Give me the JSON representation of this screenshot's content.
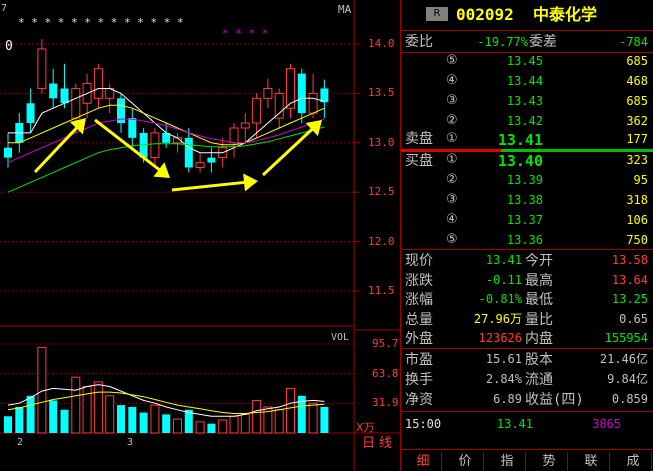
{
  "colors": {
    "up": "#ff3c3c",
    "down": "#00ffff",
    "green": "#00e600",
    "yellow": "#ffff00",
    "white": "#ffffff",
    "magenta": "#d000d0",
    "label": "#c0c0c0",
    "grid": "#a00000"
  },
  "chart": {
    "ma_label": "MA",
    "price_ticks": [
      "14.0",
      "13.5",
      "13.0",
      "12.5",
      "12.0",
      "11.5"
    ],
    "vol_label": "VOL",
    "vol_ticks": [
      "95.7",
      "63.8",
      "31.9"
    ],
    "vol_unit": "X万",
    "left_price_fragment": "0",
    "left_top_fragment": "7",
    "date_labels": [
      "2",
      "3"
    ],
    "period_button": "日线",
    "star_marks": "* * * * * * * * * * * * *",
    "star_marks_magenta": "* * * *"
  },
  "chart_data": {
    "type": "candlestick",
    "price_range": [
      11.3,
      14.2
    ],
    "vol_range": [
      0,
      100
    ],
    "candles": [
      {
        "o": 12.95,
        "h": 13.1,
        "l": 12.75,
        "c": 12.85,
        "v": 18
      },
      {
        "o": 13.2,
        "h": 13.3,
        "l": 12.9,
        "c": 13.0,
        "v": 28
      },
      {
        "o": 13.4,
        "h": 13.55,
        "l": 13.1,
        "c": 13.2,
        "v": 40
      },
      {
        "o": 13.55,
        "h": 14.05,
        "l": 13.5,
        "c": 13.95,
        "v": 92
      },
      {
        "o": 13.6,
        "h": 13.75,
        "l": 13.35,
        "c": 13.45,
        "v": 35
      },
      {
        "o": 13.55,
        "h": 13.8,
        "l": 13.35,
        "c": 13.4,
        "v": 25
      },
      {
        "o": 13.25,
        "h": 13.6,
        "l": 13.1,
        "c": 13.55,
        "v": 60
      },
      {
        "o": 13.4,
        "h": 13.7,
        "l": 13.25,
        "c": 13.6,
        "v": 50
      },
      {
        "o": 13.45,
        "h": 13.8,
        "l": 13.35,
        "c": 13.75,
        "v": 55
      },
      {
        "o": 13.45,
        "h": 13.6,
        "l": 13.3,
        "c": 13.55,
        "v": 40
      },
      {
        "o": 13.45,
        "h": 13.5,
        "l": 13.1,
        "c": 13.2,
        "v": 30
      },
      {
        "o": 13.25,
        "h": 13.35,
        "l": 12.95,
        "c": 13.05,
        "v": 28
      },
      {
        "o": 13.1,
        "h": 13.15,
        "l": 12.8,
        "c": 12.85,
        "v": 22
      },
      {
        "o": 12.85,
        "h": 13.15,
        "l": 12.75,
        "c": 13.1,
        "v": 30
      },
      {
        "o": 13.1,
        "h": 13.2,
        "l": 12.95,
        "c": 13.0,
        "v": 20
      },
      {
        "o": 13.0,
        "h": 13.1,
        "l": 12.9,
        "c": 13.05,
        "v": 15
      },
      {
        "o": 13.05,
        "h": 13.15,
        "l": 12.7,
        "c": 12.75,
        "v": 25
      },
      {
        "o": 12.75,
        "h": 12.9,
        "l": 12.7,
        "c": 12.8,
        "v": 12
      },
      {
        "o": 12.85,
        "h": 12.95,
        "l": 12.7,
        "c": 12.8,
        "v": 10
      },
      {
        "o": 12.85,
        "h": 13.05,
        "l": 12.75,
        "c": 12.95,
        "v": 14
      },
      {
        "o": 13.0,
        "h": 13.2,
        "l": 12.85,
        "c": 13.15,
        "v": 18
      },
      {
        "o": 13.15,
        "h": 13.3,
        "l": 13.0,
        "c": 13.2,
        "v": 20
      },
      {
        "o": 13.2,
        "h": 13.5,
        "l": 13.05,
        "c": 13.45,
        "v": 35
      },
      {
        "o": 13.45,
        "h": 13.65,
        "l": 13.35,
        "c": 13.55,
        "v": 28
      },
      {
        "o": 13.25,
        "h": 13.55,
        "l": 13.15,
        "c": 13.5,
        "v": 25
      },
      {
        "o": 13.35,
        "h": 13.8,
        "l": 13.25,
        "c": 13.75,
        "v": 48
      },
      {
        "o": 13.7,
        "h": 13.75,
        "l": 13.2,
        "c": 13.3,
        "v": 40
      },
      {
        "o": 13.3,
        "h": 13.7,
        "l": 13.25,
        "c": 13.5,
        "v": 32
      },
      {
        "o": 13.55,
        "h": 13.64,
        "l": 13.25,
        "c": 13.41,
        "v": 28
      }
    ],
    "ma_lines": [
      {
        "color": "#ffffff",
        "values": [
          13.1,
          13.1,
          13.1,
          13.3,
          13.35,
          13.4,
          13.45,
          13.5,
          13.55,
          13.55,
          13.5,
          13.4,
          13.3,
          13.2,
          13.1,
          13.05,
          12.95,
          12.9,
          12.9,
          12.9,
          12.95,
          13.0,
          13.1,
          13.2,
          13.3,
          13.4,
          13.45,
          13.45,
          13.42
        ]
      },
      {
        "color": "#ffff00",
        "values": [
          13.0,
          13.0,
          13.05,
          13.1,
          13.15,
          13.2,
          13.25,
          13.3,
          13.35,
          13.38,
          13.38,
          13.35,
          13.3,
          13.25,
          13.2,
          13.15,
          13.1,
          13.05,
          13.0,
          12.98,
          12.98,
          13.0,
          13.05,
          13.1,
          13.15,
          13.2,
          13.25,
          13.3,
          13.35
        ]
      },
      {
        "color": "#d000d0",
        "values": [
          12.8,
          12.85,
          12.9,
          12.95,
          13.0,
          13.05,
          13.1,
          13.15,
          13.2,
          13.22,
          13.24,
          13.24,
          13.22,
          13.2,
          13.17,
          13.14,
          13.1,
          13.07,
          13.04,
          13.02,
          13.0,
          13.0,
          13.02,
          13.05,
          13.08,
          13.12,
          13.16,
          13.2,
          13.24
        ]
      },
      {
        "color": "#00e600",
        "values": [
          12.5,
          12.55,
          12.6,
          12.65,
          12.7,
          12.75,
          12.8,
          12.85,
          12.9,
          12.93,
          12.95,
          12.97,
          12.98,
          12.99,
          12.99,
          12.99,
          12.98,
          12.97,
          12.96,
          12.96,
          12.96,
          12.97,
          12.99,
          13.01,
          13.04,
          13.07,
          13.1,
          13.13,
          13.16
        ]
      }
    ]
  },
  "panel": {
    "badge": "R",
    "code": "002092",
    "name": "中泰化学",
    "weibi_label": "委比",
    "weibi_value": "-19.77%",
    "weicha_label": "委差",
    "weicha_value": "-784",
    "sell_label": "卖盘",
    "buy_label": "买盘",
    "sell": [
      {
        "num": "⑤",
        "price": "13.45",
        "vol": "685"
      },
      {
        "num": "④",
        "price": "13.44",
        "vol": "468"
      },
      {
        "num": "③",
        "price": "13.43",
        "vol": "685"
      },
      {
        "num": "②",
        "price": "13.42",
        "vol": "362"
      },
      {
        "num": "①",
        "price": "13.41",
        "vol": "177"
      }
    ],
    "buy": [
      {
        "num": "①",
        "price": "13.40",
        "vol": "323"
      },
      {
        "num": "②",
        "price": "13.39",
        "vol": "95"
      },
      {
        "num": "③",
        "price": "13.38",
        "vol": "318"
      },
      {
        "num": "④",
        "price": "13.37",
        "vol": "106"
      },
      {
        "num": "⑤",
        "price": "13.36",
        "vol": "750"
      }
    ],
    "quote": [
      {
        "l1": "现价",
        "v1": "13.41",
        "c1": "#00e600",
        "l2": "今开",
        "v2": "13.58",
        "c2": "#ff3c3c"
      },
      {
        "l1": "涨跌",
        "v1": "-0.11",
        "c1": "#00e600",
        "l2": "最高",
        "v2": "13.64",
        "c2": "#ff3c3c"
      },
      {
        "l1": "涨幅",
        "v1": "-0.81%",
        "c1": "#00e600",
        "l2": "最低",
        "v2": "13.25",
        "c2": "#00e600"
      },
      {
        "l1": "总量",
        "v1": "27.96万",
        "c1": "#ffff00",
        "l2": "量比",
        "v2": "0.65",
        "c2": "#c0c0c0"
      },
      {
        "l1": "外盘",
        "v1": "123626",
        "c1": "#ff3c3c",
        "l2": "内盘",
        "v2": "155954",
        "c2": "#00e600"
      }
    ],
    "fund": [
      {
        "l1": "市盈",
        "v1": "15.61",
        "l2": "股本",
        "v2": "21.46亿"
      },
      {
        "l1": "换手",
        "v1": "2.84%",
        "l2": "流通",
        "v2": "9.84亿"
      },
      {
        "l1": "净资",
        "v1": "6.89",
        "l2": "收益(四)",
        "v2": "0.859"
      }
    ],
    "tick": {
      "time": "15:00",
      "price": "13.41",
      "vol": "3865"
    },
    "tabs": [
      "细",
      "价",
      "指",
      "势",
      "联",
      "成"
    ]
  }
}
